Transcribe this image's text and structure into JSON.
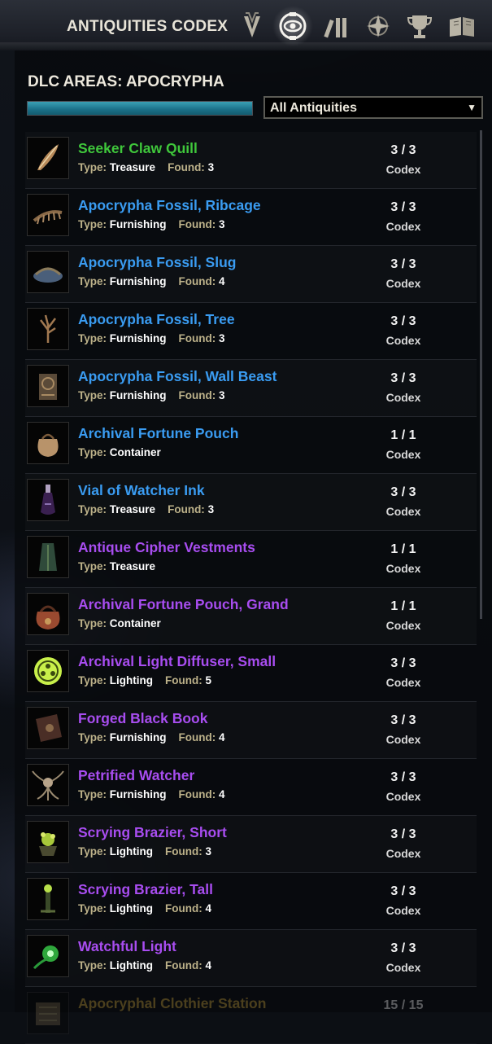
{
  "header": {
    "title": "ANTIQUITIES CODEX",
    "icons": [
      "vanguard-icon",
      "antiquities-eye-icon",
      "collections-icon",
      "compass-star-icon",
      "trophy-icon",
      "book-icon"
    ],
    "active_icon": "antiquities-eye-icon"
  },
  "area": {
    "title": "DLC AREAS: APOCRYPHA",
    "progress": 1.0
  },
  "filter": {
    "selected": "All Antiquities",
    "arrow": "▼"
  },
  "labels": {
    "type": "Type:",
    "found": "Found:",
    "codex": "Codex"
  },
  "colors": {
    "green": "#3fc73b",
    "blue": "#3a9cf2",
    "purple": "#a84df0",
    "gold": "#c8a23a"
  },
  "items": [
    {
      "name": "Seeker Claw Quill",
      "color": "green",
      "type": "Treasure",
      "found": "3",
      "count": "3 / 3",
      "codex": "Codex",
      "icon": "quill-icon"
    },
    {
      "name": "Apocrypha Fossil, Ribcage",
      "color": "blue",
      "type": "Furnishing",
      "found": "3",
      "count": "3 / 3",
      "codex": "Codex",
      "icon": "ribcage-fossil-icon"
    },
    {
      "name": "Apocrypha Fossil, Slug",
      "color": "blue",
      "type": "Furnishing",
      "found": "4",
      "count": "3 / 3",
      "codex": "Codex",
      "icon": "slug-fossil-icon"
    },
    {
      "name": "Apocrypha Fossil, Tree",
      "color": "blue",
      "type": "Furnishing",
      "found": "3",
      "count": "3 / 3",
      "codex": "Codex",
      "icon": "tree-fossil-icon"
    },
    {
      "name": "Apocrypha Fossil, Wall Beast",
      "color": "blue",
      "type": "Furnishing",
      "found": "3",
      "count": "3 / 3",
      "codex": "Codex",
      "icon": "wall-beast-fossil-icon"
    },
    {
      "name": "Archival Fortune Pouch",
      "color": "blue",
      "type": "Container",
      "found": "",
      "count": "1 / 1",
      "codex": "Codex",
      "icon": "pouch-icon"
    },
    {
      "name": "Vial of Watcher Ink",
      "color": "blue",
      "type": "Treasure",
      "found": "3",
      "count": "3 / 3",
      "codex": "Codex",
      "icon": "vial-icon"
    },
    {
      "name": "Antique Cipher Vestments",
      "color": "purple",
      "type": "Treasure",
      "found": "",
      "count": "1 / 1",
      "codex": "Codex",
      "icon": "robe-icon"
    },
    {
      "name": "Archival Fortune Pouch, Grand",
      "color": "purple",
      "type": "Container",
      "found": "",
      "count": "1 / 1",
      "codex": "Codex",
      "icon": "grand-pouch-icon"
    },
    {
      "name": "Archival Light Diffuser, Small",
      "color": "purple",
      "type": "Lighting",
      "found": "5",
      "count": "3 / 3",
      "codex": "Codex",
      "icon": "light-diffuser-icon"
    },
    {
      "name": "Forged Black Book",
      "color": "purple",
      "type": "Furnishing",
      "found": "4",
      "count": "3 / 3",
      "codex": "Codex",
      "icon": "black-book-icon"
    },
    {
      "name": "Petrified Watcher",
      "color": "purple",
      "type": "Furnishing",
      "found": "4",
      "count": "3 / 3",
      "codex": "Codex",
      "icon": "watcher-icon"
    },
    {
      "name": "Scrying Brazier, Short",
      "color": "purple",
      "type": "Lighting",
      "found": "3",
      "count": "3 / 3",
      "codex": "Codex",
      "icon": "brazier-short-icon"
    },
    {
      "name": "Scrying Brazier, Tall",
      "color": "purple",
      "type": "Lighting",
      "found": "4",
      "count": "3 / 3",
      "codex": "Codex",
      "icon": "brazier-tall-icon"
    },
    {
      "name": "Watchful Light",
      "color": "purple",
      "type": "Lighting",
      "found": "4",
      "count": "3 / 3",
      "codex": "Codex",
      "icon": "watchful-light-icon"
    },
    {
      "name": "Apocryphal Clothier Station",
      "color": "gold",
      "type": "",
      "found": "",
      "count": "15 / 15",
      "codex": "",
      "icon": "clothier-station-icon",
      "faded": true
    }
  ]
}
